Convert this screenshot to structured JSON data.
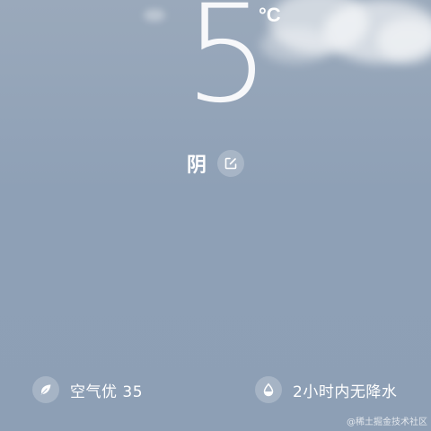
{
  "weather": {
    "temperature": "5",
    "unit": "°C",
    "condition": "阴",
    "edit_icon": "edit-icon"
  },
  "details": {
    "air_quality": {
      "icon": "leaf-icon",
      "text": "空气优 35"
    },
    "precipitation": {
      "icon": "water-drop-icon",
      "text": "2小时内无降水"
    }
  },
  "watermark": "@稀土掘金技术社区",
  "colors": {
    "sky": "#8ea0b6",
    "text": "#ffffff"
  }
}
